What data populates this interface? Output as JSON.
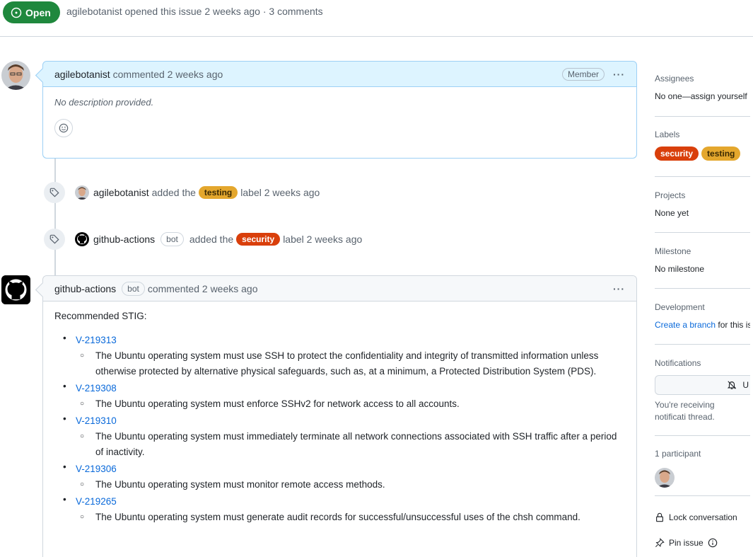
{
  "issue": {
    "status": "Open",
    "meta": "agilebotanist opened this issue 2 weeks ago · 3 comments"
  },
  "comment1": {
    "author": "agilebotanist",
    "action": "commented 2 weeks ago",
    "role_badge": "Member",
    "body": "No description provided."
  },
  "events": [
    {
      "actor": "agilebotanist",
      "before": "added the",
      "label": "testing",
      "after": "label 2 weeks ago"
    },
    {
      "actor": "github-actions",
      "bot": "bot",
      "before": "added the",
      "label": "security",
      "after": "label 2 weeks ago"
    }
  ],
  "comment2": {
    "author": "github-actions",
    "bot": "bot",
    "action": "commented 2 weeks ago",
    "heading": "Recommended STIG:",
    "items": [
      {
        "id": "V-219313",
        "desc": "The Ubuntu operating system must use SSH to protect the confidentiality and integrity of transmitted information unless otherwise protected by alternative physical safeguards, such as, at a minimum, a Protected Distribution System (PDS)."
      },
      {
        "id": "V-219308",
        "desc": "The Ubuntu operating system must enforce SSHv2 for network access to all accounts."
      },
      {
        "id": "V-219310",
        "desc": "The Ubuntu operating system must immediately terminate all network connections associated with SSH traffic after a period of inactivity."
      },
      {
        "id": "V-219306",
        "desc": "The Ubuntu operating system must monitor remote access methods."
      },
      {
        "id": "V-219265",
        "desc": "The Ubuntu operating system must generate audit records for successful/unsuccessful uses of the chsh command."
      }
    ]
  },
  "sidebar": {
    "assignees_title": "Assignees",
    "assignees_value": "No one—assign yourself",
    "labels_title": "Labels",
    "label_security": "security",
    "label_testing": "testing",
    "projects_title": "Projects",
    "projects_value": "None yet",
    "milestone_title": "Milestone",
    "milestone_value": "No milestone",
    "development_title": "Development",
    "development_link": "Create a branch",
    "development_rest": "for this is",
    "notifications_title": "Notifications",
    "notifications_button": "U",
    "notifications_text": "You're receiving notificati thread.",
    "participants_title": "1 participant",
    "lock_label": "Lock conversation",
    "pin_label": "Pin issue"
  },
  "colors": {
    "open_green": "#1f883d",
    "label_security": "#d93f0b",
    "label_testing": "#e4a72d",
    "link_blue": "#0969da"
  }
}
